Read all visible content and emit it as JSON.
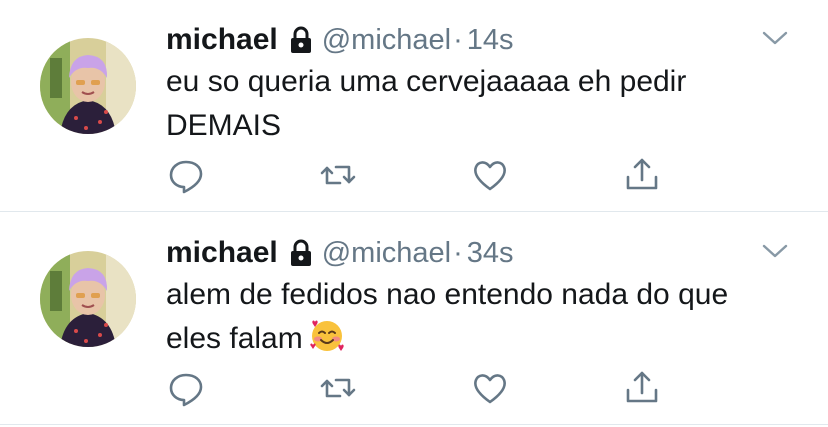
{
  "tweets": [
    {
      "name": "michael",
      "handle": "@michael",
      "separator": "·",
      "time": "14s",
      "text": "eu so queria uma cervejaaaaa eh pedir DEMAIS",
      "emoji": null,
      "protected": true,
      "icons": [
        "lock-icon",
        "chevron-down-icon",
        "reply-icon",
        "retweet-icon",
        "like-icon",
        "share-icon"
      ]
    },
    {
      "name": "michael",
      "handle": "@michael",
      "separator": "·",
      "time": "34s",
      "text": "alem de fedidos nao entendo nada do que eles falam",
      "emoji": "smiling-face-with-hearts",
      "protected": true,
      "icons": [
        "lock-icon",
        "chevron-down-icon",
        "reply-icon",
        "retweet-icon",
        "like-icon",
        "share-icon"
      ]
    }
  ],
  "colors": {
    "text": "#14171a",
    "secondary": "#657786",
    "divider": "#e1e8ed",
    "avatar_hair": "#c9a3e8"
  }
}
